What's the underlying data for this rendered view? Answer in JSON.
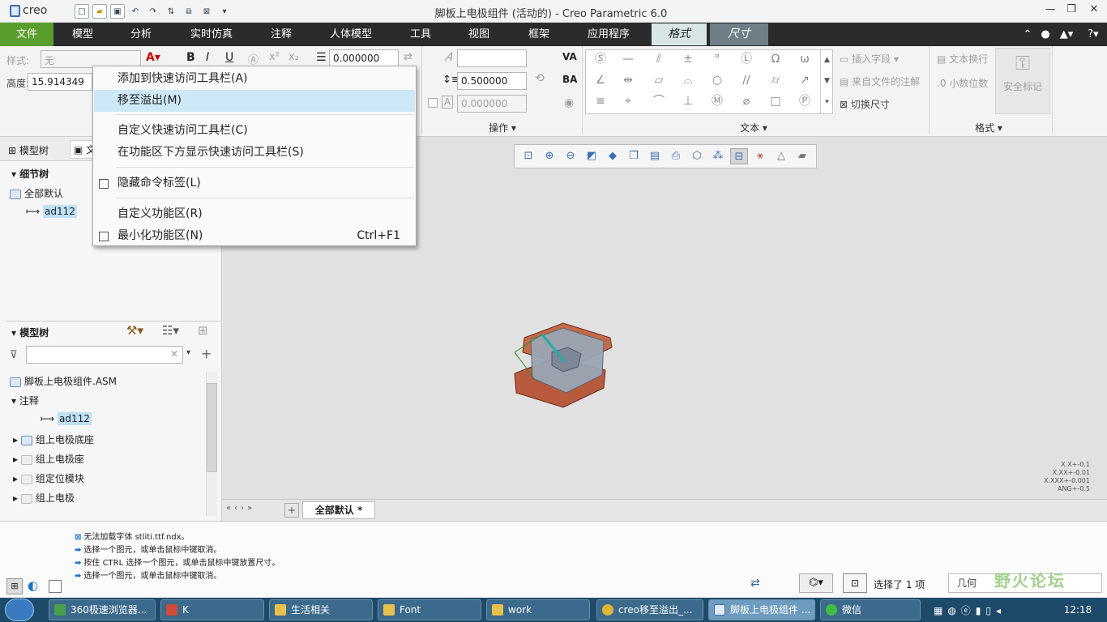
{
  "titlebar": {
    "logo": "creo",
    "title": "脚板上电极组件 (活动的) - Creo Parametric 6.0"
  },
  "menubar": {
    "tabs": [
      "文件",
      "模型",
      "分析",
      "实时仿真",
      "注释",
      "人体模型",
      "工具",
      "视图",
      "框架",
      "应用程序"
    ],
    "context_tabs": [
      "格式",
      "尺寸"
    ]
  },
  "ribbon": {
    "style_label": "样式:",
    "style_value": "无",
    "height_label": "高度:",
    "height_value": "15.914349",
    "line_value": "0.000000",
    "spacing_value": "0.500000",
    "slant_value": "0.000000",
    "groups": {
      "operate": "操作",
      "text": "文本",
      "format": "格式"
    },
    "buttons": {
      "insert_field": "插入字段",
      "from_file_note": "来自文件的注解",
      "toggle_dim": "切换尺寸",
      "text_wrap": "文本换行",
      "decimals": "小数位数",
      "safety_mark": "安全标记"
    }
  },
  "menu": {
    "items": [
      {
        "label": "添加到快速访问工具栏(A)"
      },
      {
        "label": "移至溢出(M)"
      },
      {
        "label": "自定义快速访问工具栏(C)"
      },
      {
        "label": "在功能区下方显示快速访问工具栏(S)"
      },
      {
        "label": "隐藏命令标签(L)"
      },
      {
        "label": "自定义功能区(R)"
      },
      {
        "label": "最小化功能区(N)",
        "shortcut": "Ctrl+F1"
      }
    ]
  },
  "leftpanel": {
    "tabs": [
      "模型树",
      "文"
    ],
    "detail_tree": {
      "title": "细节树",
      "root": "全部默认",
      "child": "ad112"
    },
    "model_tree": {
      "title": "模型树",
      "root": "脚板上电极组件.ASM",
      "notes": "注释",
      "note_item": "ad112",
      "items": [
        "组上电极底座",
        "组上电极座",
        "组定位模块",
        "组上电极"
      ]
    }
  },
  "graphics": {
    "tolerances": [
      "X.X+-0.1",
      "X.XX+-0.01",
      "X.XXX+-0.001",
      "ANG+-0.5"
    ]
  },
  "tabstrip": {
    "active": "全部默认 *"
  },
  "messages": [
    "无法加载字体 stliti.ttf.ndx。",
    "选择一个图元，或单击鼠标中键取消。",
    "按住 CTRL 选择一个图元，或单击鼠标中键放置尺寸。",
    "选择一个图元，或单击鼠标中键取消。"
  ],
  "status": {
    "selected": "选择了 1 项",
    "filter": "几何",
    "watermark": "野火论坛"
  },
  "taskbar": {
    "tasks": [
      "360极速浏览器...",
      "K",
      "生活相关",
      "Font",
      "work",
      "creo移至溢出_...",
      "脚板上电极组件 ...",
      "微信"
    ],
    "clock": "12:18"
  },
  "colors": {
    "file_tab": "#5a9e2f",
    "menubar": "#2b2b2b",
    "highlight": "#cde8f6",
    "taskbar": "#1e4a6a"
  }
}
